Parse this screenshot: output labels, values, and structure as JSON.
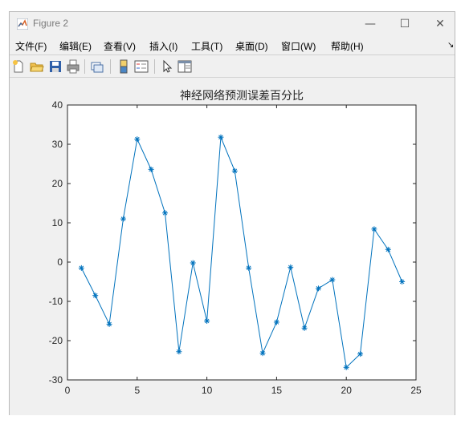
{
  "window": {
    "title": "Figure 2",
    "controls": {
      "minimize": "—",
      "maximize": "☐",
      "close": "✕"
    }
  },
  "menu": {
    "items": [
      "文件(F)",
      "编辑(E)",
      "查看(V)",
      "插入(I)",
      "工具(T)",
      "桌面(D)",
      "窗口(W)",
      "帮助(H)"
    ],
    "overflow": "↘"
  },
  "toolbar": {
    "icons": [
      "new-figure-icon",
      "open-icon",
      "save-icon",
      "print-icon",
      "link-plot-icon",
      "colorbar-icon",
      "legend-icon",
      "pointer-icon",
      "property-editor-icon"
    ]
  },
  "chart_data": {
    "type": "line",
    "title": "神经网络预测误差百分比",
    "xlabel": "",
    "ylabel": "",
    "xlim": [
      0,
      25
    ],
    "ylim": [
      -30,
      40
    ],
    "xticks": [
      "0",
      "5",
      "10",
      "15",
      "20",
      "25"
    ],
    "yticks": [
      "-30",
      "-20",
      "-10",
      "0",
      "10",
      "20",
      "30",
      "40"
    ],
    "marker": "*",
    "line_color": "#0072bd",
    "grid": false,
    "series": [
      {
        "x": [
          1,
          2,
          3,
          4,
          5,
          6,
          7,
          8,
          9,
          10,
          11,
          12,
          13,
          14,
          15,
          16,
          17,
          18,
          19,
          20,
          21,
          22,
          23,
          24
        ],
        "values": [
          -1.5,
          -8.5,
          -15.8,
          11.0,
          31.3,
          23.6,
          12.5,
          -22.8,
          -0.2,
          -15.0,
          31.8,
          23.2,
          -1.5,
          -23.2,
          -15.3,
          -1.3,
          -16.8,
          -6.7,
          -4.5,
          -26.8,
          -23.4,
          8.4,
          3.2,
          -5.0
        ]
      }
    ]
  }
}
